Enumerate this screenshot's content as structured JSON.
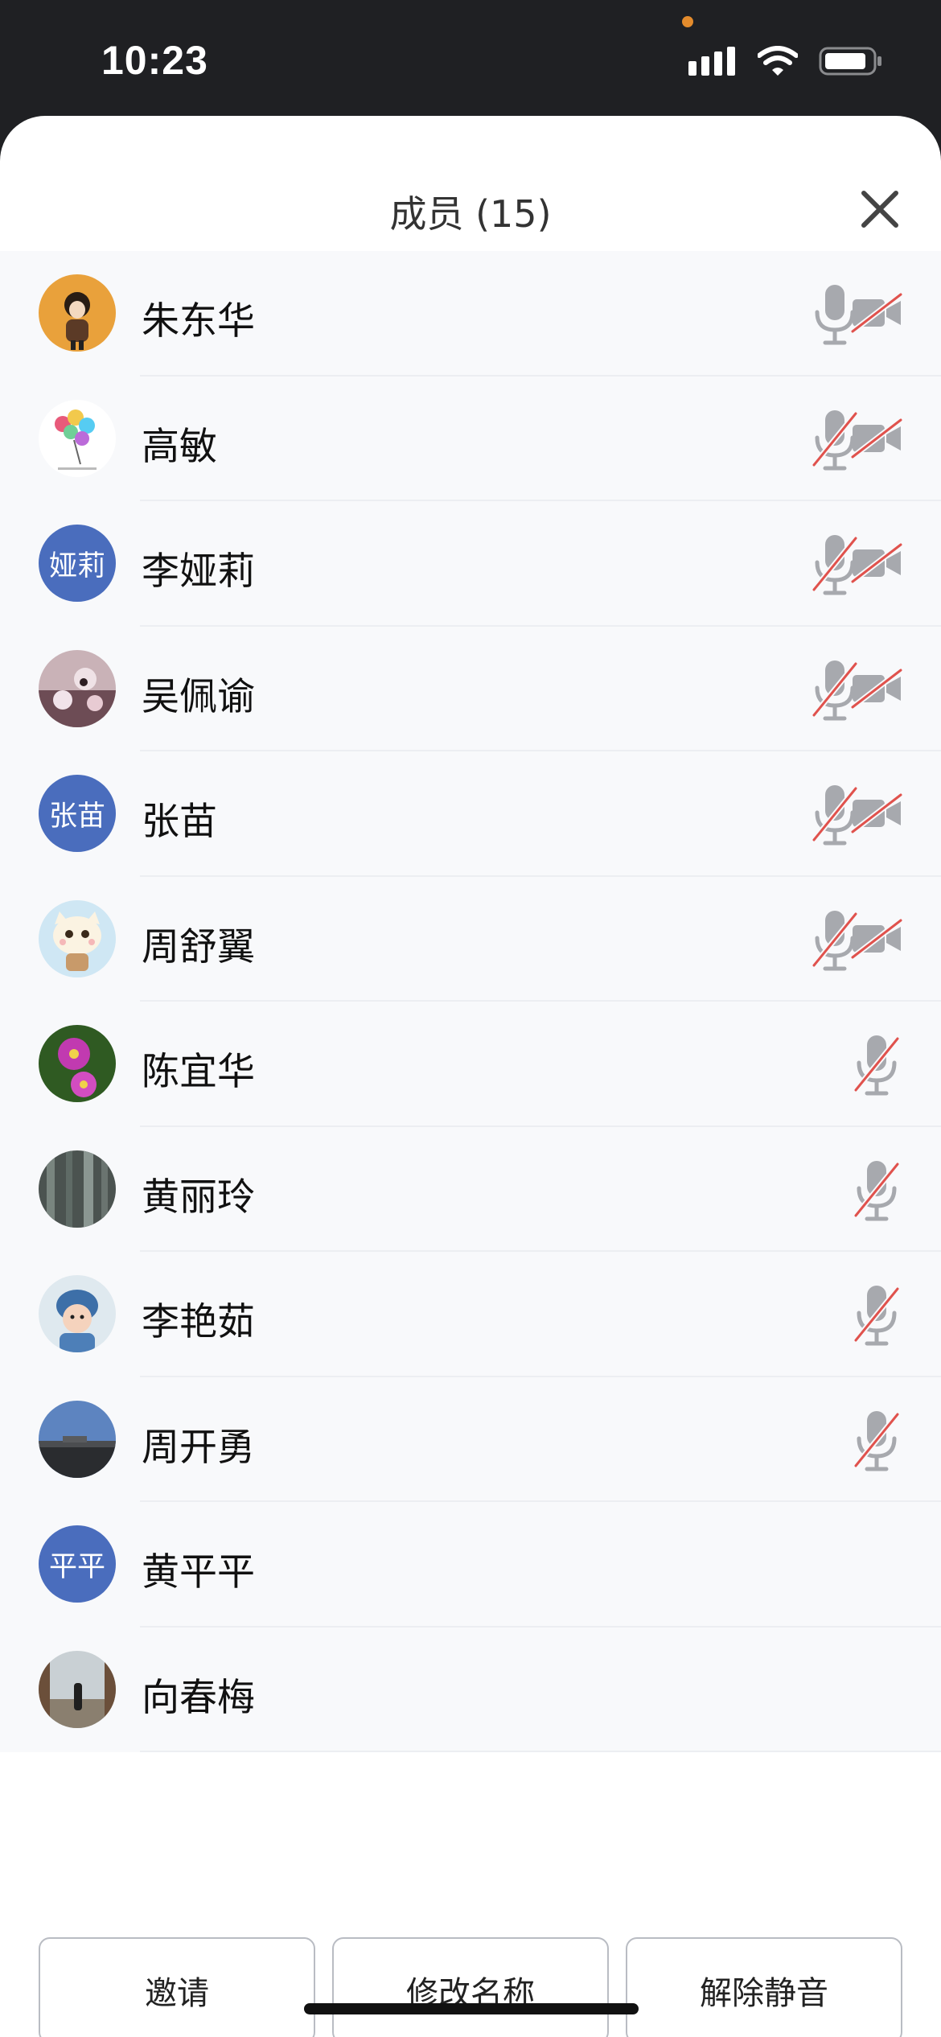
{
  "status_bar": {
    "time": "10:23"
  },
  "panel": {
    "title": "成员 (15)"
  },
  "members": [
    {
      "name": "朱东华",
      "avatar": "photo-girl-orange",
      "mic": "on",
      "camera": "off"
    },
    {
      "name": "高敏",
      "avatar": "photo-balloons",
      "mic": "muted",
      "camera": "off"
    },
    {
      "name": "李娅莉",
      "avatar_text": "娅莉",
      "mic": "muted",
      "camera": "off"
    },
    {
      "name": "吴佩谕",
      "avatar": "photo-flowers-pink",
      "mic": "muted",
      "camera": "off"
    },
    {
      "name": "张苗",
      "avatar_text": "张苗",
      "mic": "muted",
      "camera": "off"
    },
    {
      "name": "周舒翼",
      "avatar": "photo-cartoon-cat",
      "mic": "muted",
      "camera": "off"
    },
    {
      "name": "陈宜华",
      "avatar": "photo-cosmos",
      "mic": "muted"
    },
    {
      "name": "黄丽玲",
      "avatar": "photo-trees",
      "mic": "muted"
    },
    {
      "name": "李艳茹",
      "avatar": "photo-baby",
      "mic": "muted"
    },
    {
      "name": "周开勇",
      "avatar": "photo-landscape",
      "mic": "muted"
    },
    {
      "name": "黄平平",
      "avatar_text": "平平"
    },
    {
      "name": "向春梅",
      "avatar": "photo-sea"
    }
  ],
  "buttons": {
    "invite": "邀请",
    "rename": "修改名称",
    "unmute": "解除静音"
  },
  "colors": {
    "accent_avatar": "#4a6dbd",
    "mute_slash": "#e0524d",
    "icon_gray": "#a7a9ae"
  }
}
